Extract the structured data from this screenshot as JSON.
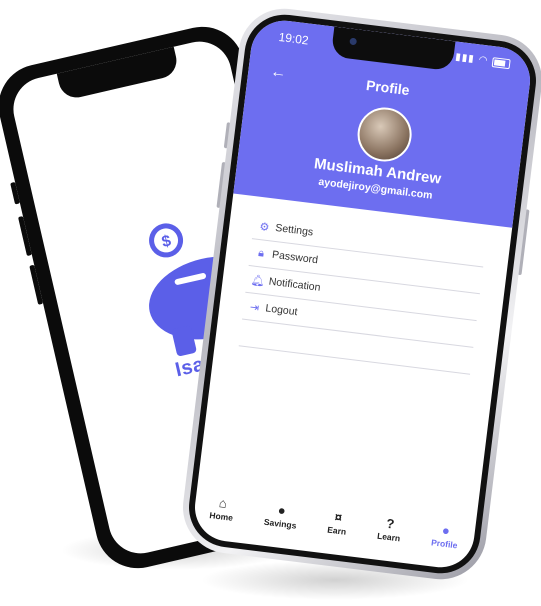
{
  "back_phone": {
    "brand_text": "Isave",
    "colors": {
      "brand": "#5b5fe8"
    }
  },
  "front_phone": {
    "status": {
      "time": "19:02"
    },
    "header": {
      "title": "Profile",
      "back_icon": "back-arrow-icon"
    },
    "profile": {
      "name": "Muslimah Andrew",
      "email": "ayodejiroy@gmail.com"
    },
    "menu": [
      {
        "label": "Settings",
        "icon": "settings-icon"
      },
      {
        "label": "Password",
        "icon": "lock-icon"
      },
      {
        "label": "Notification",
        "icon": "bell-icon"
      },
      {
        "label": "Logout",
        "icon": "logout-icon"
      }
    ],
    "tabs": [
      {
        "label": "Home",
        "icon": "home-icon"
      },
      {
        "label": "Savings",
        "icon": "piggy-bank-icon"
      },
      {
        "label": "Earn",
        "icon": "money-icon"
      },
      {
        "label": "Learn",
        "icon": "help-icon"
      },
      {
        "label": "Profile",
        "icon": "user-icon",
        "active": true
      }
    ],
    "colors": {
      "accent": "#6d6ef0"
    }
  }
}
